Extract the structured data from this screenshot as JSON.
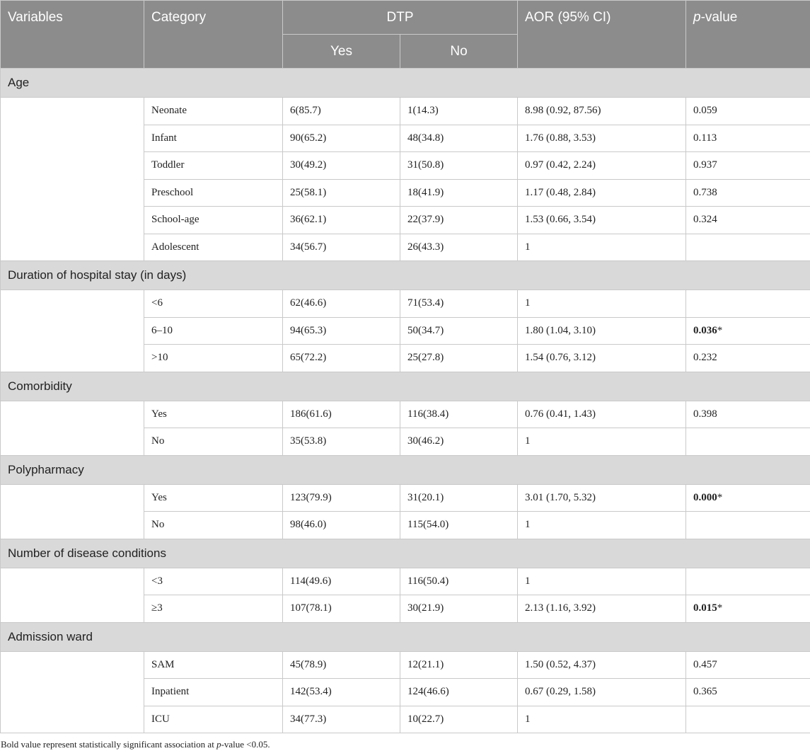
{
  "header": {
    "variables": "Variables",
    "category": "Category",
    "dtp": "DTP",
    "yes": "Yes",
    "no": "No",
    "aor": "AOR (95% CI)",
    "p_italic": "p",
    "p_rest": "-value"
  },
  "sections": [
    {
      "title": "Age",
      "rows": [
        {
          "category": "Neonate",
          "yes": "6(85.7)",
          "no": "1(14.3)",
          "aor": "8.98 (0.92, 87.56)",
          "p": "0.059",
          "sig": false
        },
        {
          "category": "Infant",
          "yes": "90(65.2)",
          "no": "48(34.8)",
          "aor": "1.76 (0.88, 3.53)",
          "p": "0.113",
          "sig": false
        },
        {
          "category": "Toddler",
          "yes": "30(49.2)",
          "no": "31(50.8)",
          "aor": "0.97 (0.42, 2.24)",
          "p": "0.937",
          "sig": false
        },
        {
          "category": "Preschool",
          "yes": "25(58.1)",
          "no": "18(41.9)",
          "aor": "1.17 (0.48, 2.84)",
          "p": "0.738",
          "sig": false
        },
        {
          "category": "School-age",
          "yes": "36(62.1)",
          "no": "22(37.9)",
          "aor": "1.53 (0.66, 3.54)",
          "p": "0.324",
          "sig": false
        },
        {
          "category": "Adolescent",
          "yes": "34(56.7)",
          "no": "26(43.3)",
          "aor": "1",
          "p": "",
          "sig": false
        }
      ]
    },
    {
      "title": "Duration of hospital stay (in days)",
      "rows": [
        {
          "category": "<6",
          "yes": "62(46.6)",
          "no": "71(53.4)",
          "aor": "1",
          "p": "",
          "sig": false
        },
        {
          "category": "6–10",
          "yes": "94(65.3)",
          "no": "50(34.7)",
          "aor": "1.80 (1.04, 3.10)",
          "p": "0.036",
          "sig": true
        },
        {
          "category": ">10",
          "yes": "65(72.2)",
          "no": "25(27.8)",
          "aor": "1.54 (0.76, 3.12)",
          "p": "0.232",
          "sig": false
        }
      ]
    },
    {
      "title": "Comorbidity",
      "rows": [
        {
          "category": "Yes",
          "yes": "186(61.6)",
          "no": "116(38.4)",
          "aor": "0.76 (0.41, 1.43)",
          "p": "0.398",
          "sig": false
        },
        {
          "category": "No",
          "yes": "35(53.8)",
          "no": "30(46.2)",
          "aor": "1",
          "p": "",
          "sig": false
        }
      ]
    },
    {
      "title": "Polypharmacy",
      "rows": [
        {
          "category": "Yes",
          "yes": "123(79.9)",
          "no": "31(20.1)",
          "aor": "3.01 (1.70, 5.32)",
          "p": "0.000",
          "sig": true
        },
        {
          "category": "No",
          "yes": "98(46.0)",
          "no": "115(54.0)",
          "aor": "1",
          "p": "",
          "sig": false
        }
      ]
    },
    {
      "title": "Number of disease conditions",
      "rows": [
        {
          "category": "<3",
          "yes": "114(49.6)",
          "no": "116(50.4)",
          "aor": "1",
          "p": "",
          "sig": false
        },
        {
          "category": "≥3",
          "yes": "107(78.1)",
          "no": "30(21.9)",
          "aor": "2.13 (1.16, 3.92)",
          "p": "0.015",
          "sig": true
        }
      ]
    },
    {
      "title": "Admission ward",
      "rows": [
        {
          "category": "SAM",
          "yes": "45(78.9)",
          "no": "12(21.1)",
          "aor": "1.50 (0.52, 4.37)",
          "p": "0.457",
          "sig": false
        },
        {
          "category": "Inpatient",
          "yes": "142(53.4)",
          "no": "124(46.6)",
          "aor": "0.67 (0.29, 1.58)",
          "p": "0.365",
          "sig": false
        },
        {
          "category": "ICU",
          "yes": "34(77.3)",
          "no": "10(22.7)",
          "aor": "1",
          "p": "",
          "sig": false
        }
      ]
    }
  ],
  "significance_marker": "*",
  "footnote": {
    "before": "Bold value represent statistically significant association at ",
    "italic": "p",
    "after": "-value <0.05."
  }
}
